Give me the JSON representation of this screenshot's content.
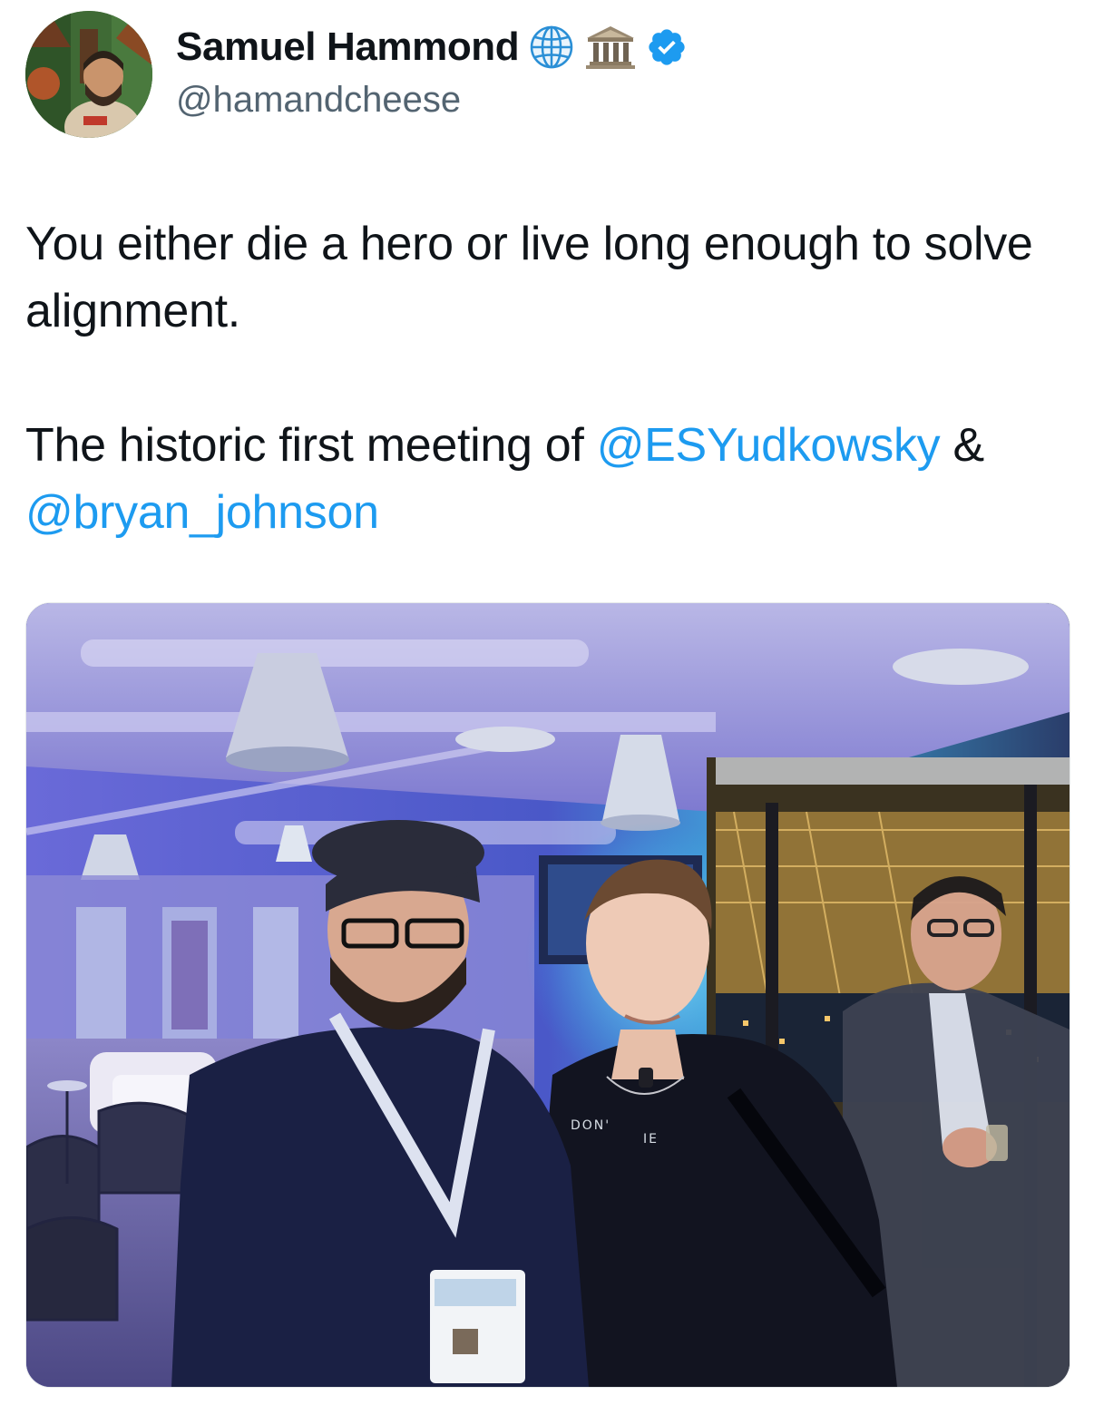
{
  "author": {
    "display_name": "Samuel Hammond",
    "handle": "@hamandcheese",
    "badges": [
      "globe-icon",
      "classical-building-icon",
      "verified-badge-icon"
    ]
  },
  "tweet": {
    "line1": "You either die a hero or live long enough to solve alignment.",
    "line2_prefix": "The historic first meeting of ",
    "mention1": "@ESYudkowsky",
    "line2_joiner": " &",
    "mention2": "@bryan_johnson"
  },
  "colors": {
    "link": "#1d9bf0",
    "verified": "#1d9bf0",
    "handle": "#536471",
    "text": "#0f1419"
  }
}
